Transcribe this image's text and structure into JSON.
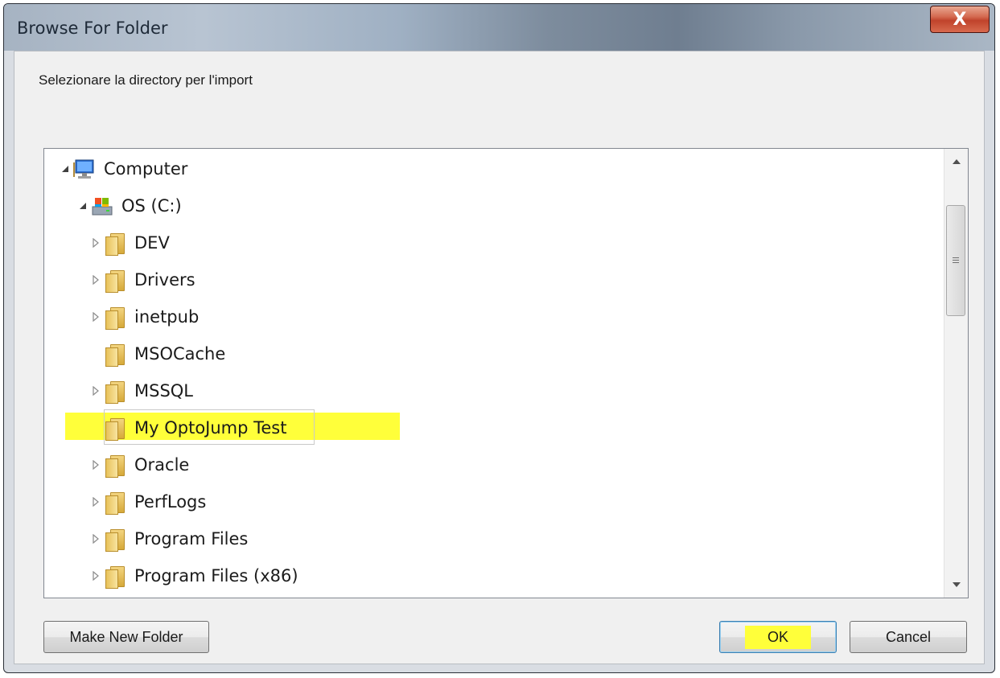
{
  "window": {
    "title": "Browse For Folder",
    "close_glyph": "X"
  },
  "prompt": "Selezionare la directory per l'import",
  "tree": {
    "items": [
      {
        "label": "Computer",
        "icon": "computer-icon",
        "expanded": true,
        "level": 0
      },
      {
        "label": "OS (C:)",
        "icon": "drive-icon",
        "expanded": true,
        "level": 1
      },
      {
        "label": "DEV",
        "icon": "folder-icon",
        "expandable": true,
        "level": 2
      },
      {
        "label": "Drivers",
        "icon": "folder-icon",
        "expandable": true,
        "level": 2
      },
      {
        "label": "inetpub",
        "icon": "folder-icon",
        "expandable": true,
        "level": 2
      },
      {
        "label": "MSOCache",
        "icon": "folder-icon",
        "expandable": false,
        "level": 2
      },
      {
        "label": "MSSQL",
        "icon": "folder-icon",
        "expandable": true,
        "level": 2
      },
      {
        "label": "My OptoJump Test",
        "icon": "folder-icon",
        "expandable": false,
        "level": 2,
        "selected": true
      },
      {
        "label": "Oracle",
        "icon": "folder-icon",
        "expandable": true,
        "level": 2
      },
      {
        "label": "PerfLogs",
        "icon": "folder-icon",
        "expandable": true,
        "level": 2
      },
      {
        "label": "Program Files",
        "icon": "folder-icon",
        "expandable": true,
        "level": 2
      },
      {
        "label": "Program Files (x86)",
        "icon": "folder-icon",
        "expandable": true,
        "level": 2
      }
    ]
  },
  "buttons": {
    "make_new_folder": "Make New Folder",
    "ok": "OK",
    "cancel": "Cancel"
  },
  "colors": {
    "highlight": "#ffff3a"
  }
}
